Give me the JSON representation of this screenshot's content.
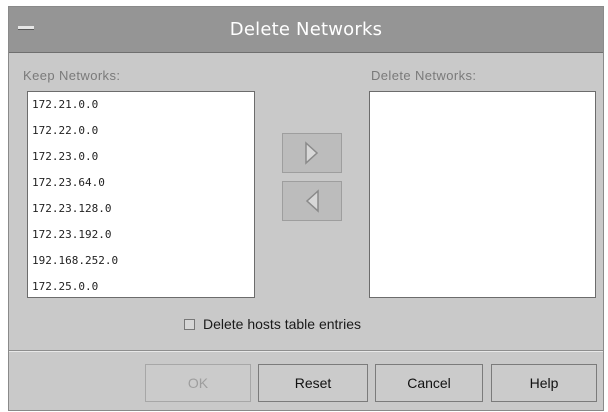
{
  "window": {
    "title": "Delete Networks"
  },
  "keep": {
    "label": "Keep Networks:",
    "items": [
      "172.21.0.0",
      "172.22.0.0",
      "172.23.0.0",
      "172.23.64.0",
      "172.23.128.0",
      "172.23.192.0",
      "192.168.252.0",
      "172.25.0.0"
    ]
  },
  "delete": {
    "label": "Delete Networks:",
    "items": []
  },
  "move": {
    "right_icon": "arrow-right-icon",
    "left_icon": "arrow-left-icon"
  },
  "option": {
    "label": "Delete hosts table entries",
    "checked": false
  },
  "buttons": {
    "ok": "OK",
    "reset": "Reset",
    "cancel": "Cancel",
    "help": "Help"
  }
}
